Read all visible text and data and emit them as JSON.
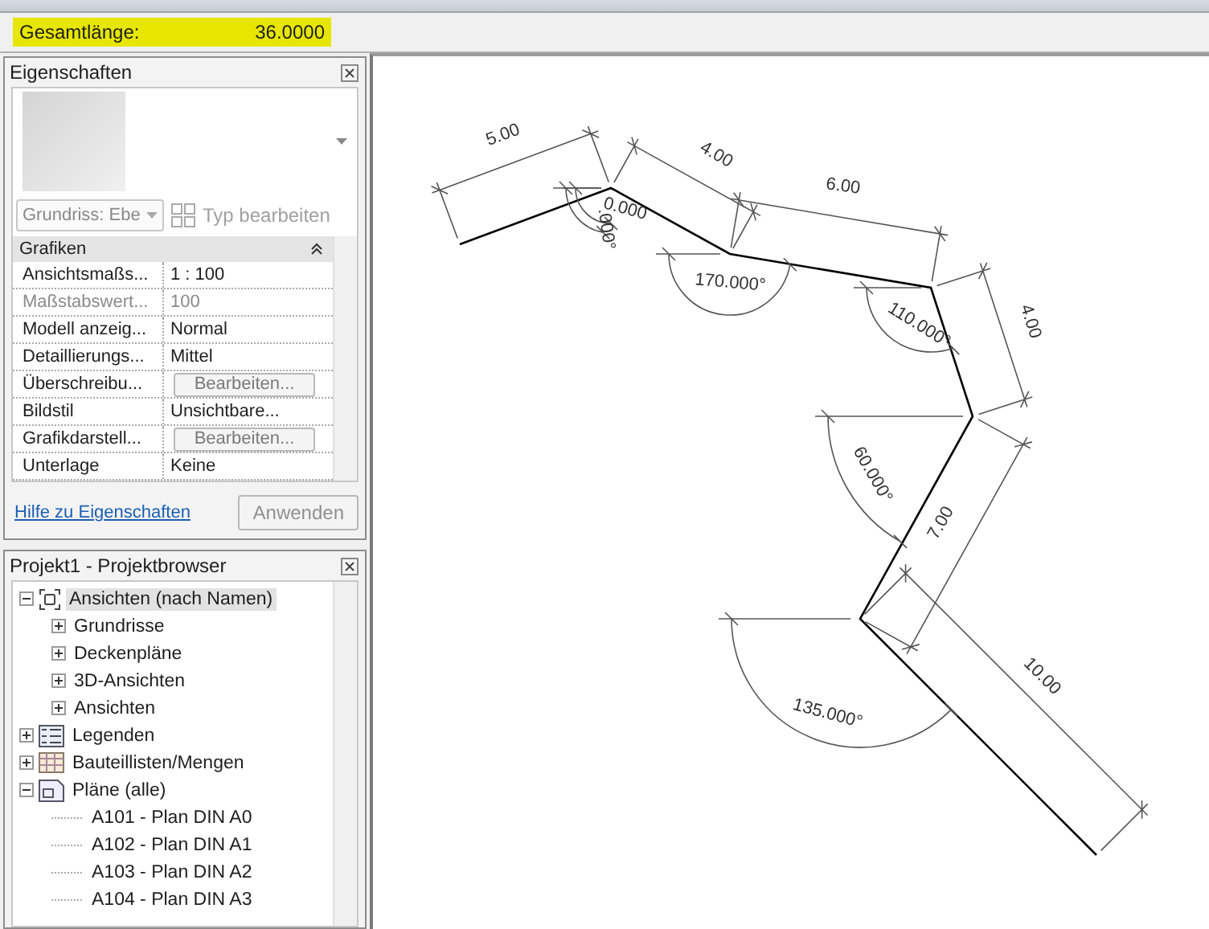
{
  "status": {
    "label": "Gesamtlänge:",
    "value": "36.0000"
  },
  "properties": {
    "title": "Eigenschaften",
    "type_selector": "Grundriss: Ebe",
    "edit_type": "Typ bearbeiten",
    "group": {
      "label": "Grafiken",
      "expanded": true
    },
    "rows": [
      {
        "name": "Ansichtsmaßs...",
        "value": "1 : 100",
        "kind": "text",
        "disabled": false
      },
      {
        "name": "Maßstabswert...",
        "value": "100",
        "kind": "text",
        "disabled": true
      },
      {
        "name": "Modell anzeig...",
        "value": "Normal",
        "kind": "text",
        "disabled": false
      },
      {
        "name": "Detaillierungs...",
        "value": "Mittel",
        "kind": "text",
        "disabled": false
      },
      {
        "name": "Überschreibu...",
        "value": "Bearbeiten...",
        "kind": "button",
        "disabled": false
      },
      {
        "name": "Bildstil",
        "value": "Unsichtbare...",
        "kind": "text",
        "disabled": false
      },
      {
        "name": "Grafikdarstell...",
        "value": "Bearbeiten...",
        "kind": "button",
        "disabled": false
      },
      {
        "name": "Unterlage",
        "value": "Keine",
        "kind": "text",
        "disabled": false
      }
    ],
    "help_link": "Hilfe zu Eigenschaften",
    "apply": {
      "label": "Anwenden",
      "disabled": true
    }
  },
  "browser": {
    "title": "Projekt1 - Projektbrowser",
    "tree": [
      {
        "label": "Ansichten (nach Namen)",
        "kind": "views",
        "expanded": true,
        "selected": true,
        "children": [
          {
            "label": "Grundrisse",
            "expanded": false,
            "selected": false
          },
          {
            "label": "Deckenpläne",
            "expanded": false,
            "selected": false
          },
          {
            "label": "3D-Ansichten",
            "expanded": false,
            "selected": false
          },
          {
            "label": "Ansichten",
            "expanded": false,
            "selected": false
          }
        ]
      },
      {
        "label": "Legenden",
        "kind": "legends",
        "expanded": false,
        "selected": false
      },
      {
        "label": "Bauteillisten/Mengen",
        "kind": "schedules",
        "expanded": false,
        "selected": false
      },
      {
        "label": "Pläne (alle)",
        "kind": "sheets",
        "expanded": true,
        "selected": false,
        "children": [
          {
            "label": "A101 - Plan DIN A0",
            "selected": false
          },
          {
            "label": "A102 - Plan DIN A1",
            "selected": false
          },
          {
            "label": "A103 - Plan DIN A2",
            "selected": false
          },
          {
            "label": "A104 - Plan DIN A3",
            "selected": false
          }
        ]
      }
    ]
  },
  "drawing": {
    "lengths": [
      "5.00",
      "4.00",
      "6.00",
      "4.00",
      "7.00",
      "10.00"
    ],
    "angles": [
      "0.000",
      ".000°",
      "170.000°",
      "110.000°",
      "60.000°",
      "135.000°"
    ]
  }
}
